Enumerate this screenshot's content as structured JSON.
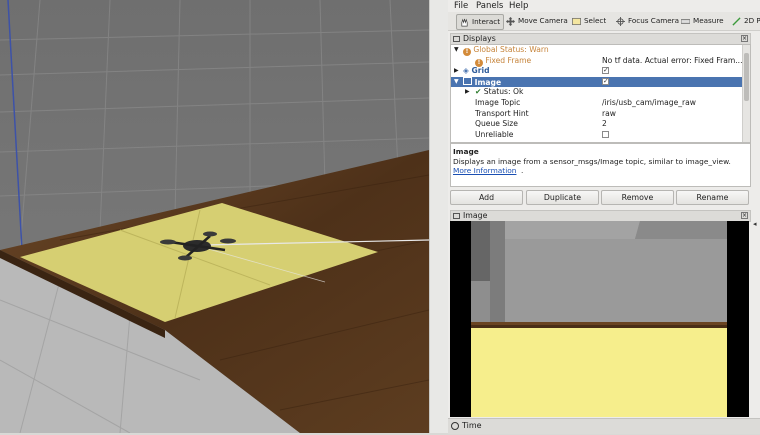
{
  "menu": {
    "file": "File",
    "panels": "Panels",
    "help": "Help"
  },
  "toolbar": {
    "interact": "Interact",
    "move_camera": "Move Camera",
    "select": "Select",
    "focus_camera": "Focus Camera",
    "measure": "Measure",
    "pose_estimate": "2D Po"
  },
  "displays": {
    "title": "Displays",
    "rows": {
      "global_status": "Global Status: Warn",
      "fixed_frame": "Fixed Frame",
      "fixed_frame_value": "No tf data.  Actual error: Fixed Fram...",
      "grid": "Grid",
      "image": "Image",
      "status_ok": "Status: Ok",
      "image_topic": "Image Topic",
      "image_topic_value": "/iris/usb_cam/image_raw",
      "transport_hint": "Transport Hint",
      "transport_hint_value": "raw",
      "queue_size": "Queue Size",
      "queue_size_value": "2",
      "unreliable": "Unreliable"
    }
  },
  "description": {
    "heading": "Image",
    "body": "Displays an image from a sensor_msgs/Image topic, similar to image_view.",
    "link": "More Information",
    "link_suffix": "."
  },
  "buttons": {
    "add": "Add",
    "duplicate": "Duplicate",
    "remove": "Remove",
    "rename": "Rename"
  },
  "image_panel": {
    "title": "Image"
  },
  "time_panel": {
    "title": "Time"
  }
}
